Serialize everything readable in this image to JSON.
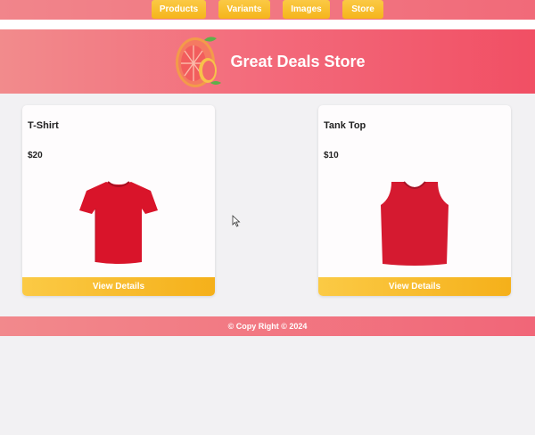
{
  "nav": {
    "items": [
      {
        "label": "Products"
      },
      {
        "label": "Variants"
      },
      {
        "label": "Images"
      },
      {
        "label": "Store"
      }
    ]
  },
  "header": {
    "title": "Great Deals Store",
    "logo_icon": "grapefruit-logo"
  },
  "products": [
    {
      "name": "T-Shirt",
      "price": "$20",
      "button_label": "View Details",
      "image_icon": "tshirt-icon",
      "color": "#d9142a"
    },
    {
      "name": "Tank Top",
      "price": "$10",
      "button_label": "View Details",
      "image_icon": "tank-top-icon",
      "color": "#d51a30"
    }
  ],
  "footer": {
    "text": "© Copy Right © 2024"
  },
  "colors": {
    "accent": "#f5b51b",
    "brand": "#f16a79"
  }
}
